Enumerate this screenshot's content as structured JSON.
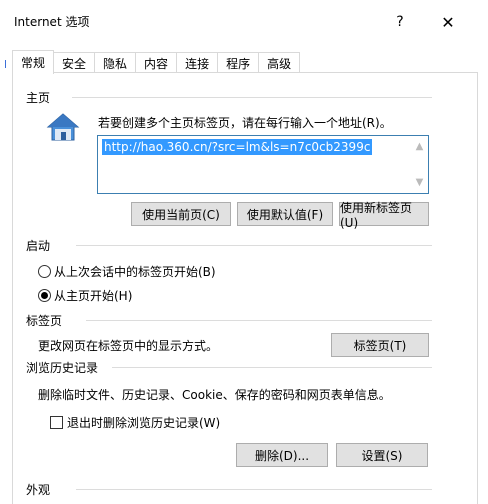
{
  "window": {
    "title": "Internet 选项",
    "help_label": "?",
    "close_label": "✕"
  },
  "tabs": [
    {
      "label": "常规",
      "active": true
    },
    {
      "label": "安全"
    },
    {
      "label": "隐私"
    },
    {
      "label": "内容"
    },
    {
      "label": "连接"
    },
    {
      "label": "程序"
    },
    {
      "label": "高级"
    }
  ],
  "home": {
    "group_label": "主页",
    "description": "若要创建多个主页标签页，请在每行输入一个地址(R)。",
    "url": "http://hao.360.cn/?src=lm&ls=n7c0cb2399c",
    "icon": "house-icon",
    "buttons": {
      "use_current": "使用当前页(C)",
      "use_default": "使用默认值(F)",
      "use_new_tab": "使用新标签页(U)"
    }
  },
  "startup": {
    "group_label": "启动",
    "option_last_session": "从上次会话中的标签页开始(B)",
    "option_home": "从主页开始(H)",
    "selected": "option_home"
  },
  "tabs_section": {
    "group_label": "标签页",
    "description": "更改网页在标签页中的显示方式。",
    "button": "标签页(T)"
  },
  "history": {
    "group_label": "浏览历史记录",
    "description": "删除临时文件、历史记录、Cookie、保存的密码和网页表单信息。",
    "checkbox_label": "退出时删除浏览历史记录(W)",
    "checkbox_checked": false,
    "delete_button": "删除(D)...",
    "settings_button": "设置(S)"
  },
  "appearance": {
    "group_label": "外观"
  }
}
